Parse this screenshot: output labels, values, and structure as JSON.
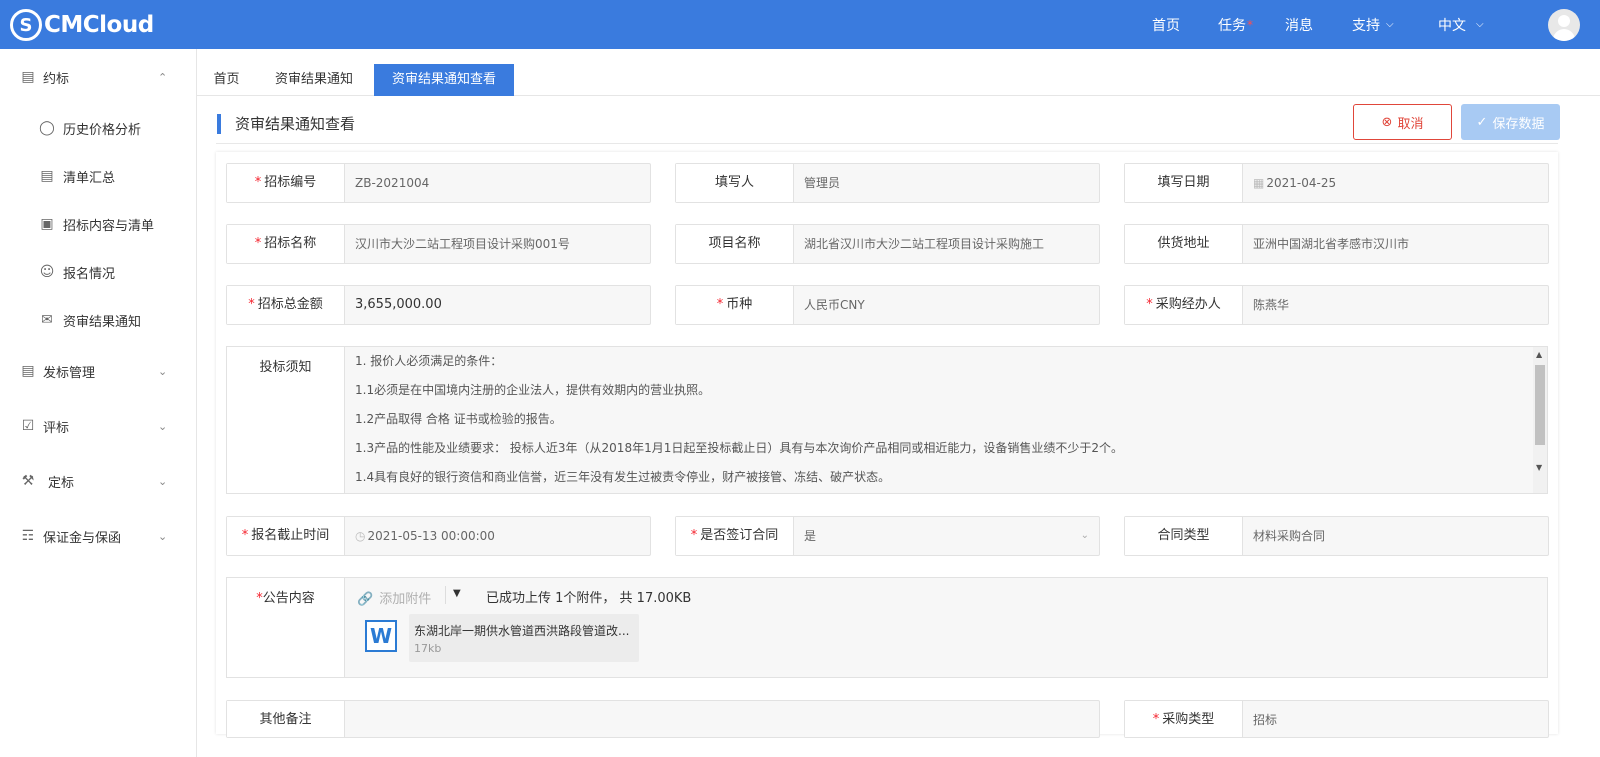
{
  "header": {
    "logo_text": "CMCloud",
    "nav": {
      "home": "首页",
      "tasks": "任务",
      "tasks_badge": "*",
      "messages": "消息",
      "support": "支持",
      "language": "中文"
    }
  },
  "sidebar": {
    "items": [
      {
        "label": "约标",
        "icon": "bidding-icon"
      },
      {
        "label": "历史价格分析",
        "icon": "price-analysis-icon"
      },
      {
        "label": "清单汇总",
        "icon": "list-summary-icon"
      },
      {
        "label": "招标内容与清单",
        "icon": "document-list-icon"
      },
      {
        "label": "报名情况",
        "icon": "user-circle-icon"
      },
      {
        "label": "资审结果通知",
        "icon": "mail-icon"
      },
      {
        "label": "发标管理",
        "icon": "publish-icon"
      },
      {
        "label": "评标",
        "icon": "evaluate-icon"
      },
      {
        "label": "定标",
        "icon": "award-icon"
      },
      {
        "label": "保证金与保函",
        "icon": "org-icon"
      }
    ]
  },
  "tabs": [
    "首页",
    "资审结果通知",
    "资审结果通知查看"
  ],
  "page": {
    "title": "资审结果通知查看",
    "cancel_label": "取消",
    "save_label": "保存数据"
  },
  "form": {
    "bid_no": {
      "label": "招标编号",
      "value": "ZB-2021004",
      "required": true
    },
    "writer": {
      "label": "填写人",
      "value": "管理员"
    },
    "write_date": {
      "label": "填写日期",
      "value": "2021-04-25"
    },
    "bid_name": {
      "label": "招标名称",
      "value": "汉川市大沙二站工程项目设计采购001号",
      "required": true
    },
    "project_name": {
      "label": "项目名称",
      "value": "湖北省汉川市大沙二站工程项目设计采购施工"
    },
    "delivery_addr": {
      "label": "供货地址",
      "value": "亚洲中国湖北省孝感市汉川市"
    },
    "total_amount": {
      "label": "招标总金额",
      "value": "3,655,000.00",
      "required": true
    },
    "currency": {
      "label": "币种",
      "value": "人民币CNY",
      "required": true
    },
    "purchaser": {
      "label": "采购经办人",
      "value": "陈燕华",
      "required": true
    },
    "notice": {
      "label": "投标须知",
      "lines": [
        "1. 报价人必须满足的条件：",
        "1.1必须是在中国境内注册的企业法人，提供有效期内的营业执照。",
        "1.2产品取得 合格  证书或检验的报告。",
        "1.3产品的性能及业绩要求： 投标人近3年（从2018年1月1日起至投标截止日）具有与本次询价产品相同或相近能力，设备销售业绩不少于2个。",
        "1.4具有良好的银行资信和商业信誉，近三年没有发生过被责令停业，财产被接管、冻结、破产状态。"
      ]
    },
    "deadline": {
      "label": "报名截止时间",
      "value": "2021-05-13 00:00:00",
      "required": true
    },
    "sign_contract": {
      "label": "是否签订合同",
      "value": "是",
      "required": true
    },
    "contract_type": {
      "label": "合同类型",
      "value": "材料采购合同"
    },
    "announcement": {
      "label": "公告内容",
      "required": true,
      "add_attachment": "添加附件",
      "upload_status": "已成功上传 1个附件， 共 17.00KB",
      "file_name": "东湖北岸一期供水管道西洪路段管道改...",
      "file_size": "17kb"
    },
    "other_notes": {
      "label": "其他备注",
      "value": ""
    },
    "purchase_type": {
      "label": "采购类型",
      "value": "招标",
      "required": true
    }
  },
  "colors": {
    "primary": "#3a7bde",
    "danger": "#e0463a",
    "disabled": "#a8caf3"
  }
}
